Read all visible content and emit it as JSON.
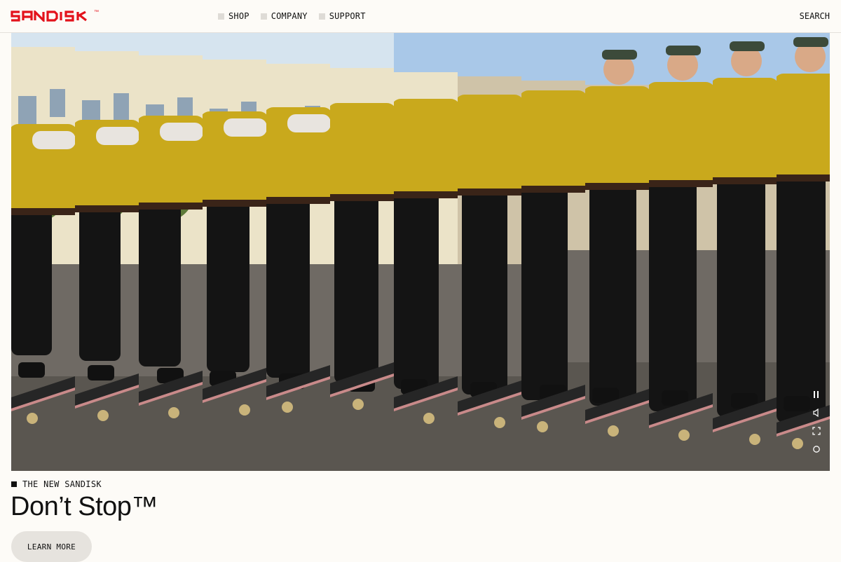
{
  "brand": {
    "logo_text": "SANDISK",
    "trademark": "™",
    "color": "#e3121b"
  },
  "nav": {
    "items": [
      {
        "label": "SHOP"
      },
      {
        "label": "COMPANY"
      },
      {
        "label": "SUPPORT"
      }
    ],
    "search_label": "SEARCH"
  },
  "hero": {
    "image_description": "Sliced photo strips of a skateboarder in a yellow t-shirt, black pants and cap riding a skateboard on a city street",
    "controls": [
      "pause-icon",
      "volume-icon",
      "fullscreen-icon",
      "replay-icon"
    ]
  },
  "content": {
    "eyebrow": "THE NEW SANDISK",
    "headline": "Don’t Stop™",
    "cta_label": "LEARN MORE"
  },
  "colors": {
    "background": "#fdfbf7",
    "accent": "#e3121b",
    "shirt": "#c9a91c",
    "pants": "#141414",
    "button_bg": "#e6e3de"
  }
}
